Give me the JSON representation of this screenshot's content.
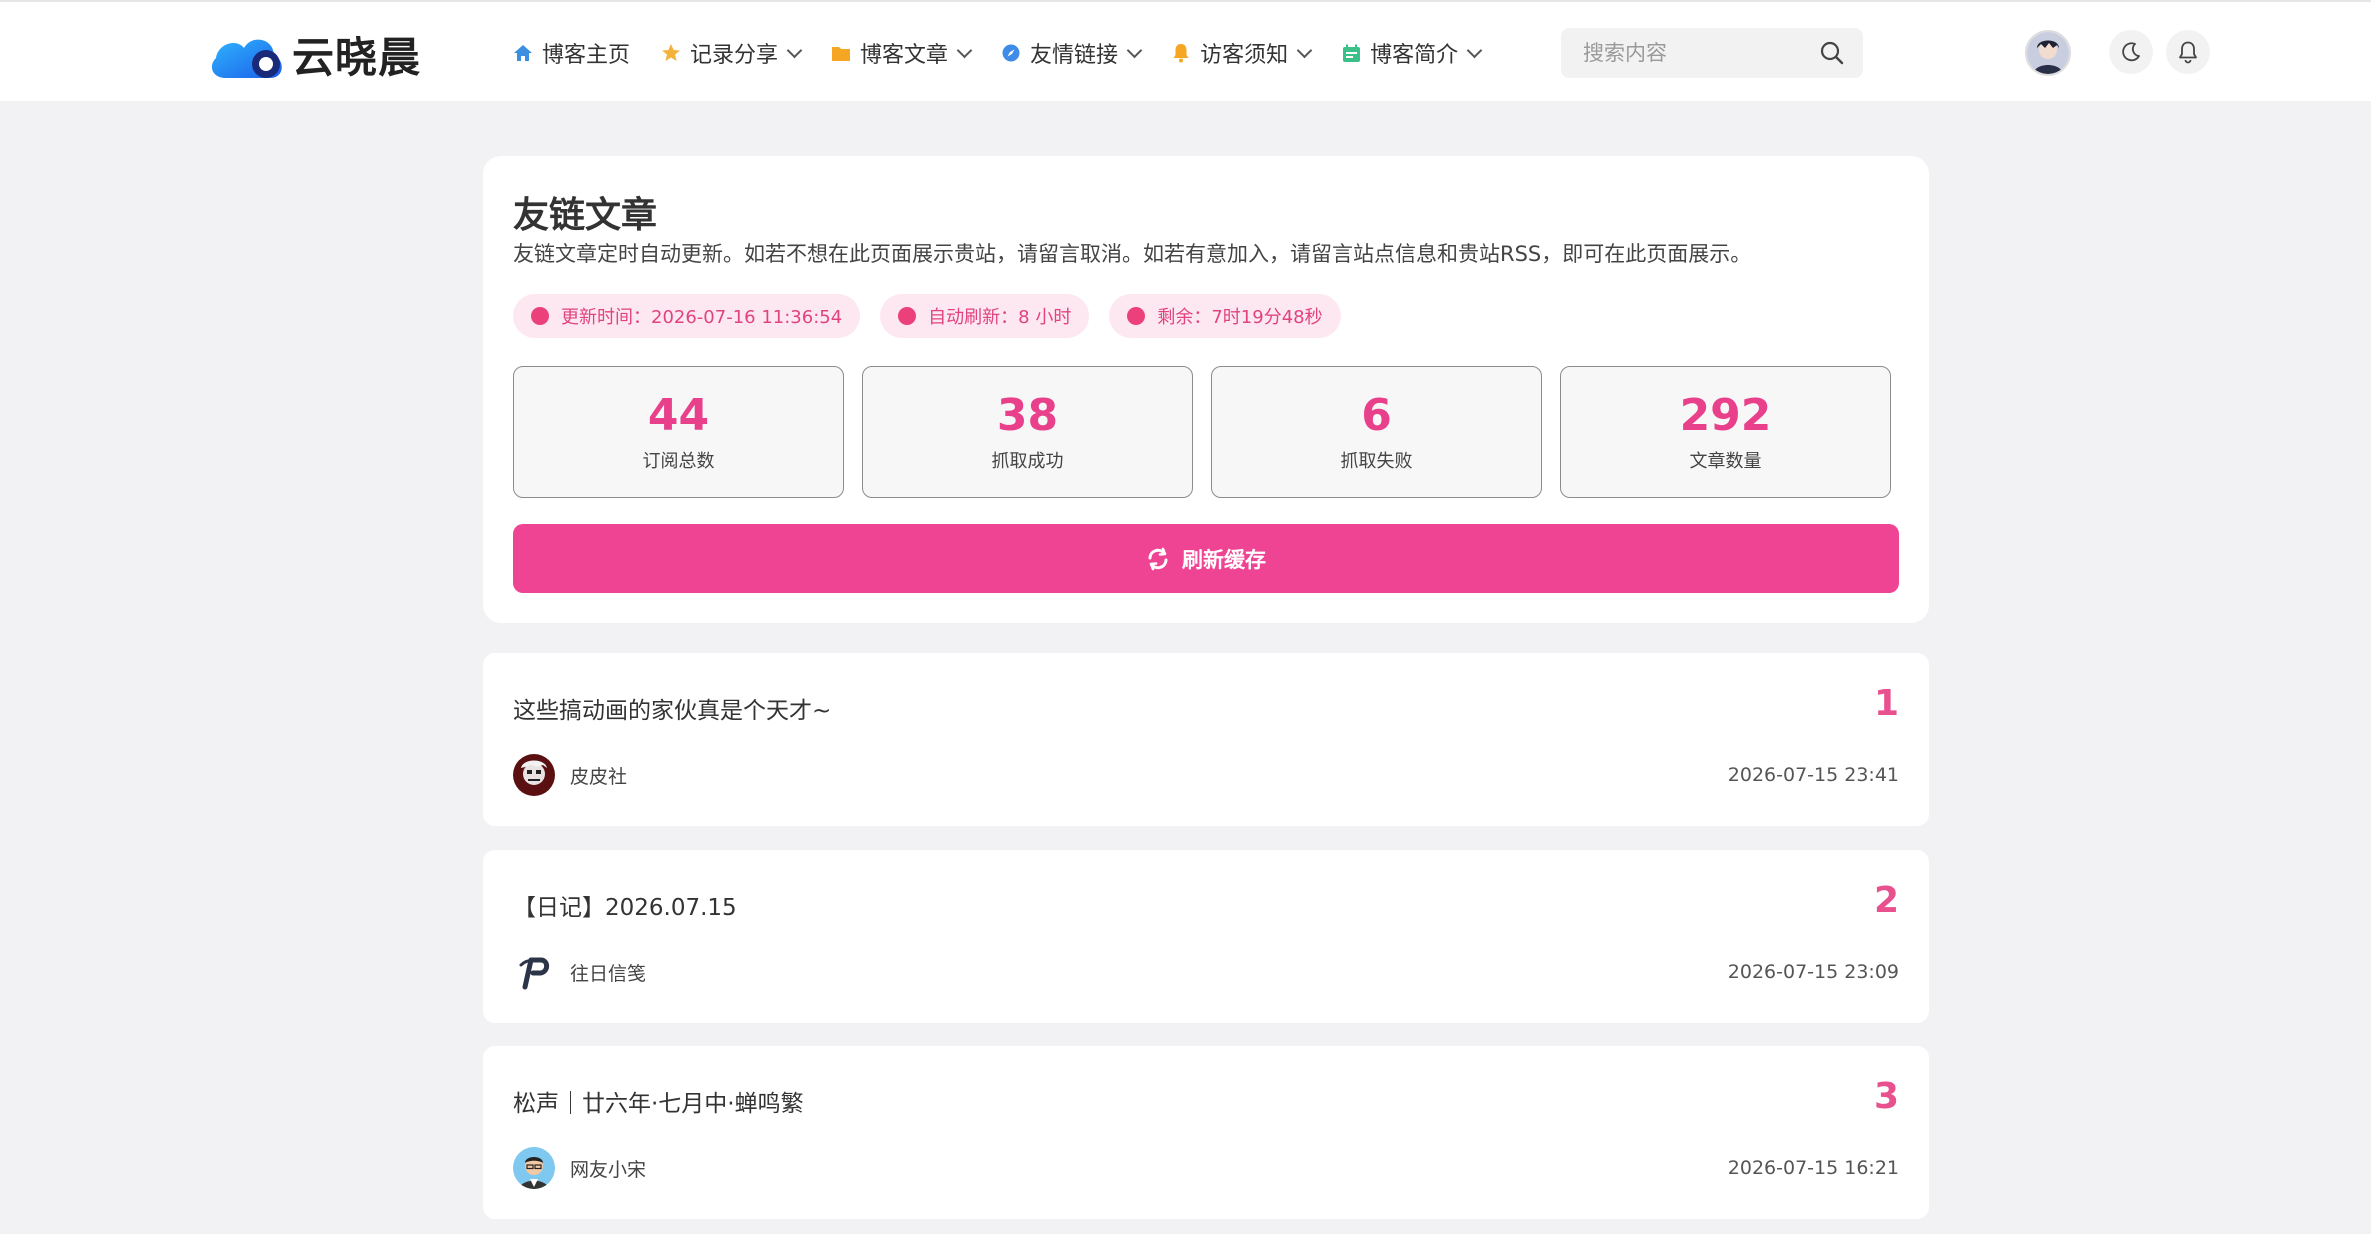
{
  "app": {
    "logo_text": "云晓晨",
    "brand_color": "#ef4493"
  },
  "nav": {
    "items": [
      {
        "label": "博客主页",
        "icon": "home-icon",
        "dropdown": false
      },
      {
        "label": "记录分享",
        "icon": "star-icon",
        "dropdown": true
      },
      {
        "label": "博客文章",
        "icon": "folder-icon",
        "dropdown": true
      },
      {
        "label": "友情链接",
        "icon": "compass-icon",
        "dropdown": true
      },
      {
        "label": "访客须知",
        "icon": "bell-icon",
        "dropdown": true
      },
      {
        "label": "博客简介",
        "icon": "calendar-icon",
        "dropdown": true
      }
    ]
  },
  "search": {
    "placeholder": "搜索内容"
  },
  "header": {
    "title": "友链文章",
    "description": "友链文章定时自动更新。如若不想在此页面展示贵站，请留言取消。如若有意加入，请留言站点信息和贵站RSS，即可在此页面展示。",
    "pills": {
      "update_time": "更新时间：2026-07-16 11:36:54",
      "auto_refresh": "自动刷新：8 小时",
      "remaining": "剩余：7时19分48秒"
    },
    "stats": {
      "subscriptions": {
        "value": "44",
        "label": "订阅总数"
      },
      "success": {
        "value": "38",
        "label": "抓取成功"
      },
      "failed": {
        "value": "6",
        "label": "抓取失败"
      },
      "articles": {
        "value": "292",
        "label": "文章数量"
      }
    },
    "refresh_button": "刷新缓存"
  },
  "posts": [
    {
      "title": "这些搞动画的家伙真是个天才~",
      "rank": "1",
      "author": "皮皮社",
      "date": "2026-07-15 23:41"
    },
    {
      "title": "【日记】2026.07.15",
      "rank": "2",
      "author": "往日信笺",
      "date": "2026-07-15 23:09"
    },
    {
      "title": "松声｜廿六年·七月中·蝉鸣繁",
      "rank": "3",
      "author": "网友小宋",
      "date": "2026-07-15 16:21"
    }
  ]
}
